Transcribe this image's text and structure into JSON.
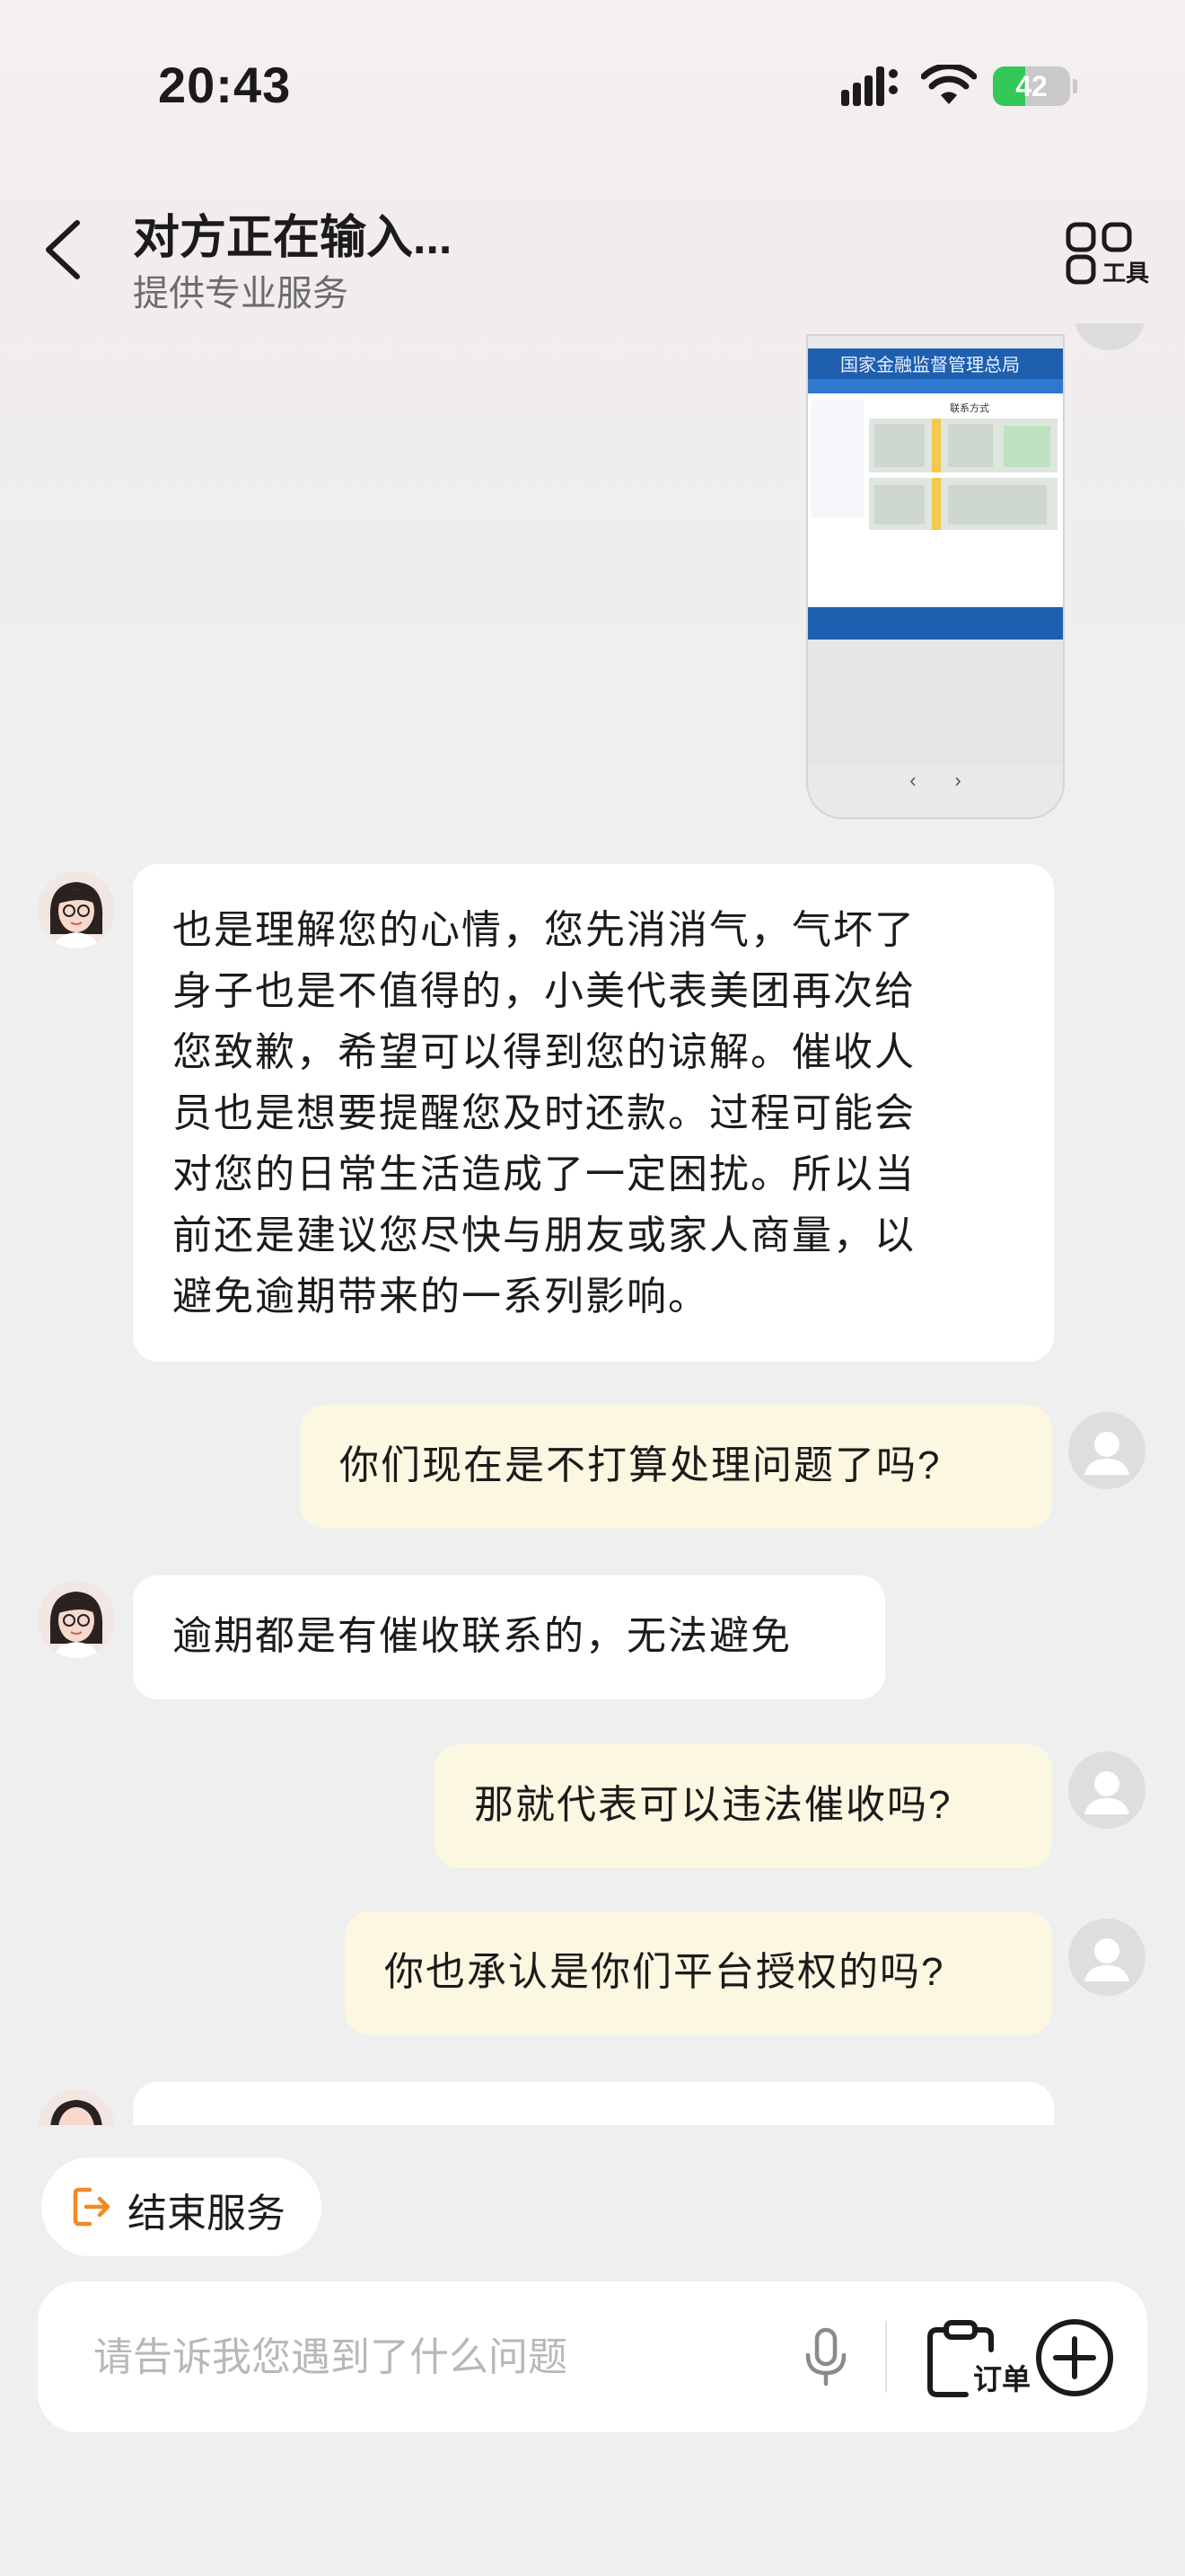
{
  "status_bar": {
    "time": "20:43",
    "battery": "42",
    "battery_level_percent": 42
  },
  "header": {
    "title": "对方正在输入...",
    "subtitle": "提供专业服务",
    "tools_label": "工具"
  },
  "shared_screenshot": {
    "site_title": "国家金融监督管理总局",
    "page_title": "联系方式"
  },
  "messages": [
    {
      "role": "agent",
      "lines": [
        "也是理解您的心情，您先消消气，气坏了",
        "身子也是不值得的，小美代表美团再次给",
        "您致歉，希望可以得到您的谅解。催收人",
        "员也是想要提醒您及时还款。过程可能会",
        "对您的日常生活造成了一定困扰。所以当",
        "前还是建议您尽快与朋友或家人商量，以",
        "避免逾期带来的一系列影响。"
      ]
    },
    {
      "role": "user",
      "text": "你们现在是不打算处理问题了吗?"
    },
    {
      "role": "agent",
      "text": "逾期都是有催收联系的，无法避免"
    },
    {
      "role": "user",
      "text": "那就代表可以违法催收吗?"
    },
    {
      "role": "user",
      "text": "你也承认是你们平台授权的吗?"
    }
  ],
  "actions": {
    "end_service_label": "结束服务"
  },
  "input": {
    "placeholder": "请告诉我您遇到了什么问题",
    "value": "",
    "order_label": "订单"
  },
  "colors": {
    "user_bubble": "#fbf7e1",
    "agent_bubble": "#ffffff",
    "accent_orange": "#f08a24",
    "battery_green": "#35c759"
  },
  "icons": [
    "back-arrow-icon",
    "tools-grid-icon",
    "signal-icon",
    "wifi-icon",
    "battery-icon",
    "exit-icon",
    "microphone-icon",
    "order-clipboard-icon",
    "plus-circle-icon"
  ]
}
